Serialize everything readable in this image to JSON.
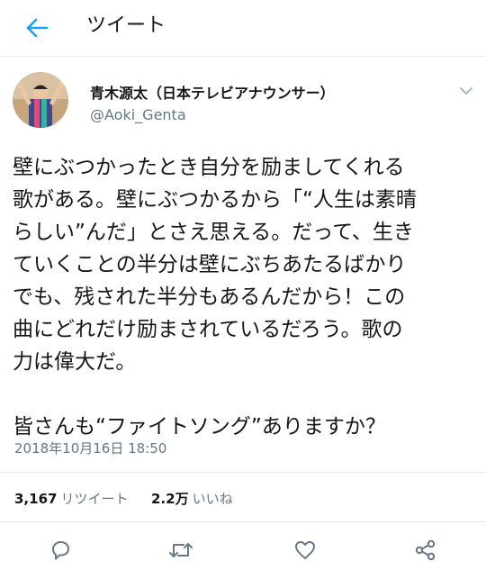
{
  "header": {
    "back_icon": "arrow-left-icon",
    "title": "ツイート"
  },
  "author": {
    "display_name": "青木源太（日本テレビアナウンサー）",
    "handle": "@Aoki_Genta"
  },
  "tweet": {
    "lines": [
      "壁にぶつかったとき自分を励ましてくれる",
      "歌がある。壁にぶつかるから「“人生は素晴",
      "らしい”んだ」とさえ思える。だって、生き",
      "ていくことの半分は壁にぶちあたるばかり",
      "でも、残された半分もあるんだから！この",
      "曲にどれだけ励まされているだろう。歌の",
      "力は偉大だ。",
      "",
      "皆さんも“ファイトソング”ありますか？"
    ],
    "timestamp": "2018年10月16日 18:50"
  },
  "stats": {
    "retweets_count": "3,167",
    "retweets_label": "リツイート",
    "likes_count": "2.2万",
    "likes_label": "いいね"
  },
  "actions": [
    "reply-icon",
    "retweet-icon",
    "like-icon",
    "share-icon"
  ],
  "colors": {
    "accent": "#1da1f2",
    "text": "#14171a",
    "secondary_text": "#657786",
    "icon": "#657786",
    "divider": "#e6ecf0"
  }
}
